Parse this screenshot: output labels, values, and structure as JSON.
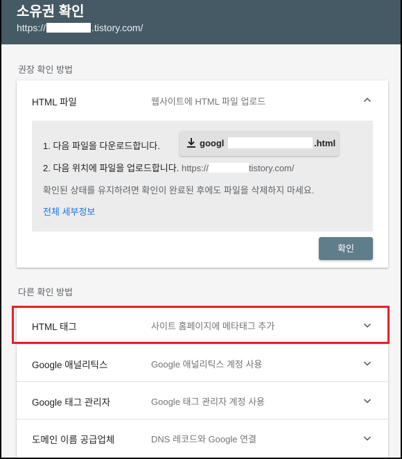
{
  "header": {
    "title": "소유권 확인",
    "url_prefix": "https://",
    "url_suffix": ".tistory.com/"
  },
  "recommended": {
    "section_label": "권장 확인 방법",
    "method_title": "HTML 파일",
    "method_desc": "웹사이트에 HTML 파일 업로드",
    "step1": "1. 다음 파일을 다운로드합니다.",
    "download_prefix": "googl",
    "download_suffix": ".html",
    "step2": "2. 다음 위치에 파일을 업로드합니다.",
    "upload_url_prefix": "https://",
    "upload_url_suffix": "tistory.com/",
    "note": "확인된 상태를 유지하려면 확인이 완료된 후에도 파일을 삭제하지 마세요.",
    "details_link": "전체 세부정보",
    "confirm_button": "확인"
  },
  "other": {
    "section_label": "다른 확인 방법",
    "methods": [
      {
        "title": "HTML 태그",
        "desc": "사이트 홈페이지에 메타태그 추가"
      },
      {
        "title": "Google 애널리틱스",
        "desc": "Google 애널리틱스 계정 사용"
      },
      {
        "title": "Google 태그 관리자",
        "desc": "Google 태그 관리자 계정 사용"
      },
      {
        "title": "도메인 이름 공급업체",
        "desc": "DNS 레코드와 Google 연결"
      }
    ]
  },
  "colors": {
    "header_bg": "#455a64",
    "confirm_button": "#607d8b",
    "link": "#1a73e8",
    "highlight_border": "#e4202a"
  },
  "icons": {
    "download": "download-icon",
    "expand_less": "chevron-up-icon",
    "expand_more": "chevron-down-icon"
  }
}
